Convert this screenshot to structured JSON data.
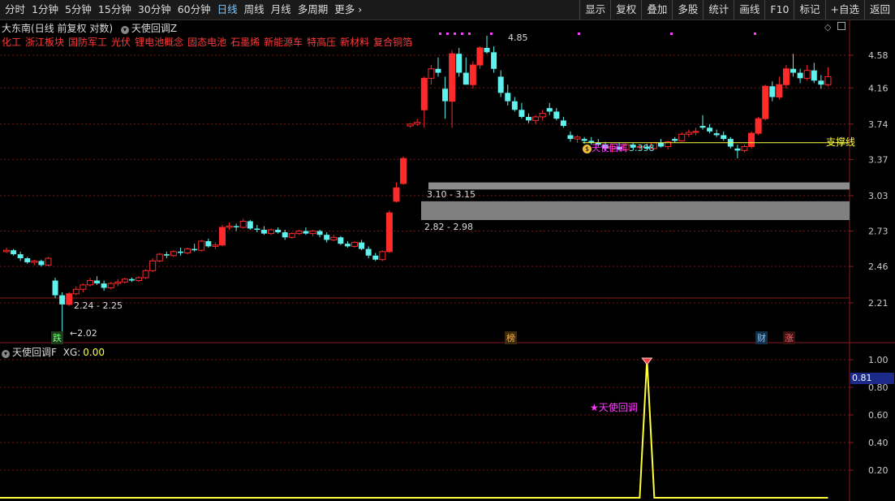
{
  "toolbar": {
    "periods": [
      "分时",
      "1分钟",
      "5分钟",
      "15分钟",
      "30分钟",
      "60分钟",
      "日线",
      "周线",
      "月线",
      "多周期",
      "更多"
    ],
    "active_period": "日线",
    "buttons": [
      "显示",
      "复权",
      "叠加",
      "多股",
      "统计",
      "画线",
      "F10",
      "标记",
      "+自选",
      "返回"
    ]
  },
  "stock": {
    "name": "大东南",
    "mode": "(日线 前复权 对数)",
    "indicator_main": "天使回调Z"
  },
  "concepts": [
    "化工",
    "浙江板块",
    "国防军工",
    "光伏",
    "锂电池概念",
    "固态电池",
    "石墨烯",
    "新能源车",
    "特高压",
    "新材料",
    "复合铜箔"
  ],
  "price_axis": [
    "4.58",
    "4.16",
    "3.74",
    "3.37",
    "3.03",
    "2.73",
    "2.46",
    "2.21"
  ],
  "annotations": {
    "high": "4.85",
    "low": "2.02",
    "zone_top": "3.10 - 3.15",
    "zone_mid": "2.82 - 2.98",
    "zone_low": "2.24 - 2.25",
    "support": "支撑线",
    "angel_main": "天使回调",
    "angel_number": "3.398",
    "badge_die": "跌",
    "badge_bang": "榜",
    "badge_cai": "财",
    "badge_zhang": "涨"
  },
  "sub": {
    "title": "天使回调F",
    "xg_label": "XG:",
    "xg_value": "0.00",
    "axis": [
      "1.00",
      "0.80",
      "0.60",
      "0.40",
      "0.20"
    ],
    "cursor_value": "0.81",
    "marker_label": "天使回调"
  },
  "colors": {
    "up": "#ff2a2a",
    "down": "#5ef1ee",
    "grid": "#7a1414",
    "concept": "#ff3a3a",
    "signal": "#ffff3c",
    "marker": "#ff3cff"
  },
  "chart_data": {
    "type": "candlestick",
    "price_ticks": [
      4.58,
      4.16,
      3.74,
      3.37,
      3.03,
      2.73,
      2.46,
      2.21
    ],
    "ohlc": [
      [
        2.57,
        2.6,
        2.56,
        2.58
      ],
      [
        2.58,
        2.59,
        2.54,
        2.55
      ],
      [
        2.55,
        2.57,
        2.5,
        2.52
      ],
      [
        2.52,
        2.53,
        2.48,
        2.49
      ],
      [
        2.49,
        2.51,
        2.47,
        2.5
      ],
      [
        2.5,
        2.51,
        2.46,
        2.47
      ],
      [
        2.47,
        2.53,
        2.46,
        2.52
      ],
      [
        2.36,
        2.38,
        2.24,
        2.26
      ],
      [
        2.26,
        2.28,
        2.02,
        2.2
      ],
      [
        2.2,
        2.28,
        2.19,
        2.27
      ],
      [
        2.27,
        2.32,
        2.26,
        2.3
      ],
      [
        2.3,
        2.34,
        2.28,
        2.33
      ],
      [
        2.33,
        2.38,
        2.32,
        2.36
      ],
      [
        2.36,
        2.39,
        2.33,
        2.34
      ],
      [
        2.34,
        2.36,
        2.29,
        2.31
      ],
      [
        2.31,
        2.35,
        2.3,
        2.34
      ],
      [
        2.34,
        2.37,
        2.32,
        2.35
      ],
      [
        2.35,
        2.38,
        2.34,
        2.37
      ],
      [
        2.37,
        2.38,
        2.35,
        2.36
      ],
      [
        2.36,
        2.39,
        2.35,
        2.38
      ],
      [
        2.38,
        2.44,
        2.37,
        2.43
      ],
      [
        2.43,
        2.52,
        2.42,
        2.5
      ],
      [
        2.5,
        2.56,
        2.49,
        2.55
      ],
      [
        2.55,
        2.57,
        2.52,
        2.54
      ],
      [
        2.54,
        2.58,
        2.53,
        2.57
      ],
      [
        2.57,
        2.6,
        2.54,
        2.56
      ],
      [
        2.56,
        2.6,
        2.55,
        2.59
      ],
      [
        2.59,
        2.63,
        2.57,
        2.58
      ],
      [
        2.58,
        2.66,
        2.57,
        2.65
      ],
      [
        2.65,
        2.67,
        2.6,
        2.61
      ],
      [
        2.61,
        2.64,
        2.59,
        2.62
      ],
      [
        2.62,
        2.78,
        2.61,
        2.76
      ],
      [
        2.76,
        2.8,
        2.74,
        2.77
      ],
      [
        2.77,
        2.79,
        2.73,
        2.76
      ],
      [
        2.76,
        2.83,
        2.75,
        2.81
      ],
      [
        2.81,
        2.82,
        2.74,
        2.75
      ],
      [
        2.75,
        2.78,
        2.72,
        2.74
      ],
      [
        2.74,
        2.77,
        2.7,
        2.71
      ],
      [
        2.71,
        2.75,
        2.7,
        2.74
      ],
      [
        2.74,
        2.76,
        2.71,
        2.72
      ],
      [
        2.72,
        2.74,
        2.66,
        2.68
      ],
      [
        2.68,
        2.72,
        2.67,
        2.71
      ],
      [
        2.71,
        2.74,
        2.7,
        2.73
      ],
      [
        2.73,
        2.76,
        2.7,
        2.71
      ],
      [
        2.71,
        2.74,
        2.69,
        2.73
      ],
      [
        2.73,
        2.74,
        2.68,
        2.7
      ],
      [
        2.7,
        2.72,
        2.64,
        2.66
      ],
      [
        2.66,
        2.7,
        2.65,
        2.68
      ],
      [
        2.68,
        2.69,
        2.62,
        2.63
      ],
      [
        2.63,
        2.65,
        2.6,
        2.61
      ],
      [
        2.61,
        2.65,
        2.6,
        2.64
      ],
      [
        2.64,
        2.66,
        2.58,
        2.59
      ],
      [
        2.59,
        2.61,
        2.52,
        2.54
      ],
      [
        2.54,
        2.56,
        2.5,
        2.51
      ],
      [
        2.51,
        2.58,
        2.5,
        2.57
      ],
      [
        2.57,
        2.9,
        2.56,
        2.88
      ],
      [
        2.98,
        3.15,
        2.97,
        3.1
      ],
      [
        3.14,
        3.4,
        3.13,
        3.38
      ],
      [
        3.72,
        3.75,
        3.7,
        3.74
      ],
      [
        3.74,
        3.8,
        3.72,
        3.76
      ],
      [
        3.9,
        4.3,
        3.7,
        4.28
      ],
      [
        4.28,
        4.45,
        4.2,
        4.4
      ],
      [
        4.4,
        4.55,
        4.3,
        4.35
      ],
      [
        4.15,
        4.3,
        3.8,
        4.0
      ],
      [
        4.0,
        4.65,
        3.7,
        4.6
      ],
      [
        4.6,
        4.68,
        4.3,
        4.35
      ],
      [
        4.35,
        4.55,
        4.2,
        4.2
      ],
      [
        4.2,
        4.5,
        4.15,
        4.45
      ],
      [
        4.45,
        4.7,
        4.4,
        4.68
      ],
      [
        4.68,
        4.85,
        4.6,
        4.62
      ],
      [
        4.62,
        4.7,
        4.35,
        4.4
      ],
      [
        4.3,
        4.38,
        4.05,
        4.1
      ],
      [
        4.1,
        4.2,
        3.95,
        4.0
      ],
      [
        4.0,
        4.05,
        3.88,
        3.9
      ],
      [
        3.9,
        3.98,
        3.8,
        3.82
      ],
      [
        3.82,
        3.86,
        3.75,
        3.78
      ],
      [
        3.78,
        3.84,
        3.74,
        3.82
      ],
      [
        3.82,
        3.9,
        3.78,
        3.86
      ],
      [
        3.92,
        3.98,
        3.84,
        3.88
      ],
      [
        3.88,
        3.92,
        3.78,
        3.8
      ],
      [
        3.78,
        3.82,
        3.7,
        3.72
      ],
      [
        3.62,
        3.66,
        3.55,
        3.58
      ],
      [
        3.58,
        3.62,
        3.54,
        3.6
      ],
      [
        3.58,
        3.6,
        3.53,
        3.56
      ],
      [
        3.56,
        3.6,
        3.52,
        3.54
      ],
      [
        3.54,
        3.58,
        3.5,
        3.52
      ],
      [
        3.52,
        3.55,
        3.46,
        3.48
      ],
      [
        3.48,
        3.52,
        3.44,
        3.5
      ],
      [
        3.5,
        3.54,
        3.46,
        3.47
      ],
      [
        3.47,
        3.53,
        3.45,
        3.52
      ],
      [
        3.52,
        3.54,
        3.48,
        3.49
      ],
      [
        3.49,
        3.52,
        3.46,
        3.5
      ],
      [
        3.5,
        3.53,
        3.47,
        3.48
      ],
      [
        3.48,
        3.55,
        3.47,
        3.54
      ],
      [
        3.54,
        3.58,
        3.49,
        3.5
      ],
      [
        3.5,
        3.56,
        3.47,
        3.55
      ],
      [
        3.58,
        3.6,
        3.54,
        3.56
      ],
      [
        3.56,
        3.65,
        3.55,
        3.63
      ],
      [
        3.63,
        3.68,
        3.6,
        3.65
      ],
      [
        3.65,
        3.7,
        3.62,
        3.66
      ],
      [
        3.72,
        3.84,
        3.68,
        3.7
      ],
      [
        3.7,
        3.74,
        3.64,
        3.66
      ],
      [
        3.64,
        3.68,
        3.6,
        3.62
      ],
      [
        3.62,
        3.66,
        3.56,
        3.58
      ],
      [
        3.58,
        3.6,
        3.48,
        3.5
      ],
      [
        3.48,
        3.52,
        3.38,
        3.46
      ],
      [
        3.46,
        3.52,
        3.44,
        3.5
      ],
      [
        3.5,
        3.66,
        3.48,
        3.64
      ],
      [
        3.64,
        3.82,
        3.62,
        3.8
      ],
      [
        3.8,
        4.2,
        3.78,
        4.18
      ],
      [
        4.18,
        4.24,
        4.0,
        4.05
      ],
      [
        4.05,
        4.3,
        4.02,
        4.2
      ],
      [
        4.2,
        4.45,
        4.15,
        4.4
      ],
      [
        4.4,
        4.6,
        4.3,
        4.35
      ],
      [
        4.35,
        4.4,
        4.22,
        4.28
      ],
      [
        4.28,
        4.45,
        4.25,
        4.38
      ],
      [
        4.38,
        4.48,
        4.22,
        4.25
      ],
      [
        4.25,
        4.32,
        4.15,
        4.2
      ],
      [
        4.2,
        4.42,
        4.18,
        4.3
      ]
    ],
    "support_level": 3.54,
    "zones": [
      {
        "label": "3.10 - 3.15",
        "lo": 3.1,
        "hi": 3.15
      },
      {
        "label": "2.82 - 2.98",
        "lo": 2.82,
        "hi": 2.98
      }
    ],
    "xg_signal": {
      "axis_ticks": [
        1.0,
        0.8,
        0.6,
        0.4,
        0.2
      ],
      "spike_index": 92,
      "spike_value": 1.0,
      "baseline": 0.0
    }
  }
}
